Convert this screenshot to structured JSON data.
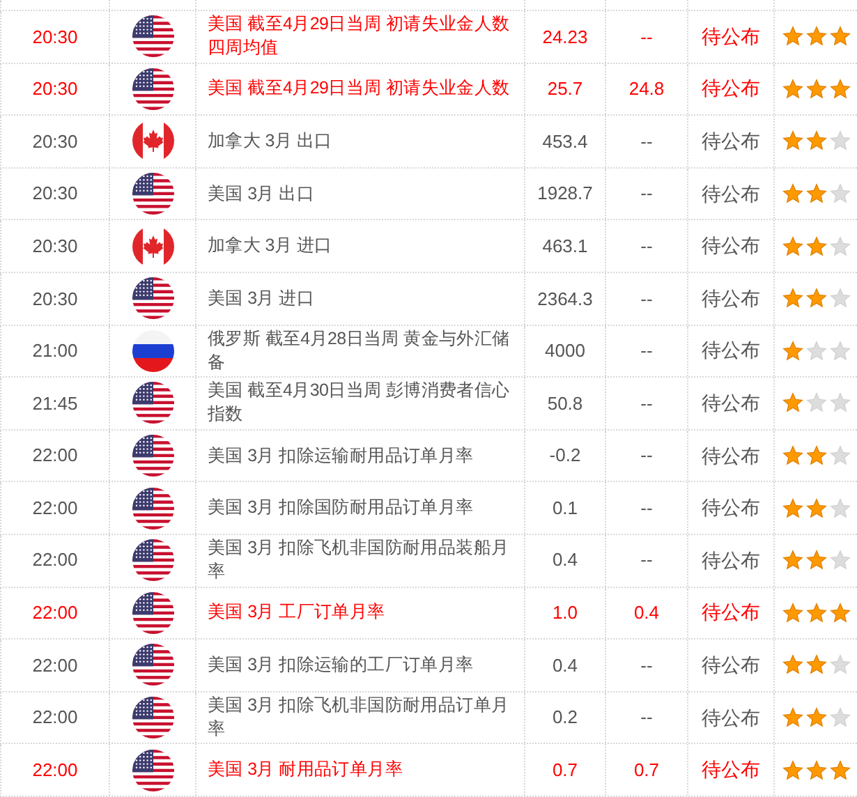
{
  "rows": [
    {
      "time": "20:30",
      "kind": "us",
      "event": "美国 截至4月29日当周 初请失业金人数四周均值",
      "previous": "24.23",
      "forecast": "--",
      "actual": "待公布",
      "stars": 3
    },
    {
      "time": "20:30",
      "kind": "us",
      "event": "美国 截至4月29日当周 初请失业金人数",
      "previous": "25.7",
      "forecast": "24.8",
      "actual": "待公布",
      "stars": 3
    },
    {
      "time": "20:30",
      "kind": "ca",
      "event": "加拿大 3月 出口",
      "previous": "453.4",
      "forecast": "--",
      "actual": "待公布",
      "stars": 2
    },
    {
      "time": "20:30",
      "kind": "us",
      "event": "美国 3月 出口",
      "previous": "1928.7",
      "forecast": "--",
      "actual": "待公布",
      "stars": 2
    },
    {
      "time": "20:30",
      "kind": "ca",
      "event": "加拿大 3月 进口",
      "previous": "463.1",
      "forecast": "--",
      "actual": "待公布",
      "stars": 2
    },
    {
      "time": "20:30",
      "kind": "us",
      "event": "美国 3月 进口",
      "previous": "2364.3",
      "forecast": "--",
      "actual": "待公布",
      "stars": 2
    },
    {
      "time": "21:00",
      "kind": "ru",
      "event": "俄罗斯 截至4月28日当周 黄金与外汇储备",
      "previous": "4000",
      "forecast": "--",
      "actual": "待公布",
      "stars": 1
    },
    {
      "time": "21:45",
      "kind": "us",
      "event": "美国 截至4月30日当周 彭博消费者信心指数",
      "previous": "50.8",
      "forecast": "--",
      "actual": "待公布",
      "stars": 1
    },
    {
      "time": "22:00",
      "kind": "us",
      "event": "美国 3月 扣除运输耐用品订单月率",
      "previous": "-0.2",
      "forecast": "--",
      "actual": "待公布",
      "stars": 2
    },
    {
      "time": "22:00",
      "kind": "us",
      "event": "美国 3月 扣除国防耐用品订单月率",
      "previous": "0.1",
      "forecast": "--",
      "actual": "待公布",
      "stars": 2
    },
    {
      "time": "22:00",
      "kind": "us",
      "event": "美国 3月 扣除飞机非国防耐用品装船月率",
      "previous": "0.4",
      "forecast": "--",
      "actual": "待公布",
      "stars": 2
    },
    {
      "time": "22:00",
      "kind": "us",
      "event": "美国 3月 工厂订单月率",
      "previous": "1.0",
      "forecast": "0.4",
      "actual": "待公布",
      "stars": 3
    },
    {
      "time": "22:00",
      "kind": "us",
      "event": "美国 3月 扣除运输的工厂订单月率",
      "previous": "0.4",
      "forecast": "--",
      "actual": "待公布",
      "stars": 2
    },
    {
      "time": "22:00",
      "kind": "us",
      "event": "美国 3月 扣除飞机非国防耐用品订单月率",
      "previous": "0.2",
      "forecast": "--",
      "actual": "待公布",
      "stars": 2
    },
    {
      "time": "22:00",
      "kind": "us",
      "event": "美国 3月 耐用品订单月率",
      "previous": "0.7",
      "forecast": "0.7",
      "actual": "待公布",
      "stars": 3
    }
  ]
}
